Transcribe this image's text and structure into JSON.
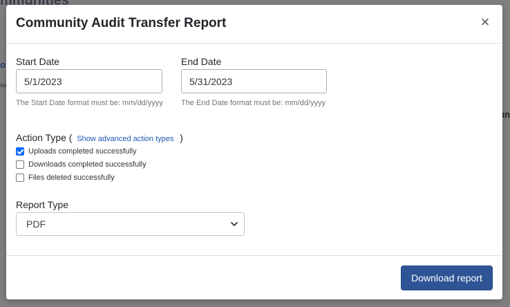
{
  "background": {
    "title_fragment": "mmunities",
    "side_fragment": "or",
    "side_small_fragment": "sa",
    "right_fragment": "un"
  },
  "modal": {
    "title": "Community Audit Transfer Report",
    "close_glyph": "×",
    "start_date": {
      "label": "Start Date",
      "value": "5/1/2023",
      "help": "The Start Date format must be: mm/dd/yyyy"
    },
    "end_date": {
      "label": "End Date",
      "value": "5/31/2023",
      "help": "The End Date format must be: mm/dd/yyyy"
    },
    "action_type": {
      "label": "Action Type (",
      "advanced_link": "Show advanced action types",
      "close_paren": ")",
      "options": [
        {
          "label": "Uploads completed successfully",
          "checked": true
        },
        {
          "label": "Downloads completed successfully",
          "checked": false
        },
        {
          "label": "Files deleted successfully",
          "checked": false
        }
      ]
    },
    "report_type": {
      "label": "Report Type",
      "selected": "PDF"
    },
    "download_label": "Download report"
  },
  "colors": {
    "primary": "#2f5496",
    "checkbox_accent": "#0d6efd",
    "link": "#1a56b0"
  },
  "icons": {
    "close": "close-icon",
    "select": "chevron-down-icon",
    "checked": "checkmark-icon"
  }
}
